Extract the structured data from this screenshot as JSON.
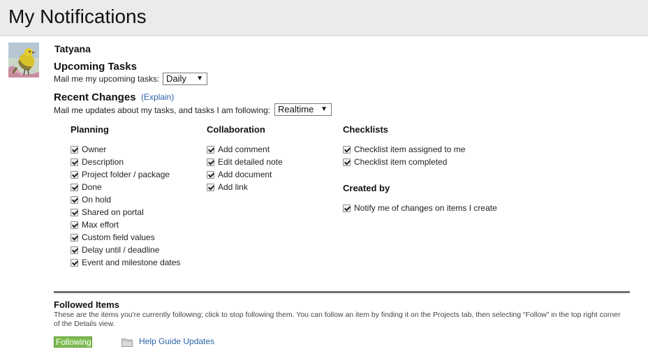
{
  "header": {
    "title": "My Notifications"
  },
  "user": {
    "name": "Tatyana"
  },
  "upcoming": {
    "title": "Upcoming Tasks",
    "label": "Mail me my upcoming tasks:",
    "selected": "Daily"
  },
  "recent": {
    "title": "Recent Changes",
    "explain": "(Explain)",
    "label": "Mail me updates about my tasks, and tasks I am following:",
    "selected": "Realtime"
  },
  "planning": {
    "title": "Planning",
    "items": [
      {
        "label": "Owner",
        "checked": true
      },
      {
        "label": "Description",
        "checked": true
      },
      {
        "label": "Project folder / package",
        "checked": true
      },
      {
        "label": "Done",
        "checked": true
      },
      {
        "label": "On hold",
        "checked": true
      },
      {
        "label": "Shared on portal",
        "checked": true
      },
      {
        "label": "Max effort",
        "checked": true
      },
      {
        "label": "Custom field values",
        "checked": true
      },
      {
        "label": "Delay until / deadline",
        "checked": true
      },
      {
        "label": "Event and milestone dates",
        "checked": true
      }
    ]
  },
  "collaboration": {
    "title": "Collaboration",
    "items": [
      {
        "label": "Add comment",
        "checked": true
      },
      {
        "label": "Edit detailed note",
        "checked": true
      },
      {
        "label": "Add document",
        "checked": true
      },
      {
        "label": "Add link",
        "checked": true
      }
    ]
  },
  "checklists": {
    "title": "Checklists",
    "items": [
      {
        "label": "Checklist item assigned to me",
        "checked": true
      },
      {
        "label": "Checklist item completed",
        "checked": true
      }
    ]
  },
  "created_by": {
    "title": "Created by",
    "items": [
      {
        "label": "Notify me of changes on items I create",
        "checked": true
      }
    ]
  },
  "followed": {
    "title": "Followed Items",
    "description": "These are the items you're currently following; click to stop following them. You can follow an item by finding it on the Projects tab, then selecting “Follow” in the top right corner of the Details view.",
    "items": [
      {
        "status": "Following",
        "name": "Help Guide Updates",
        "icon": "folder-icon"
      }
    ]
  }
}
